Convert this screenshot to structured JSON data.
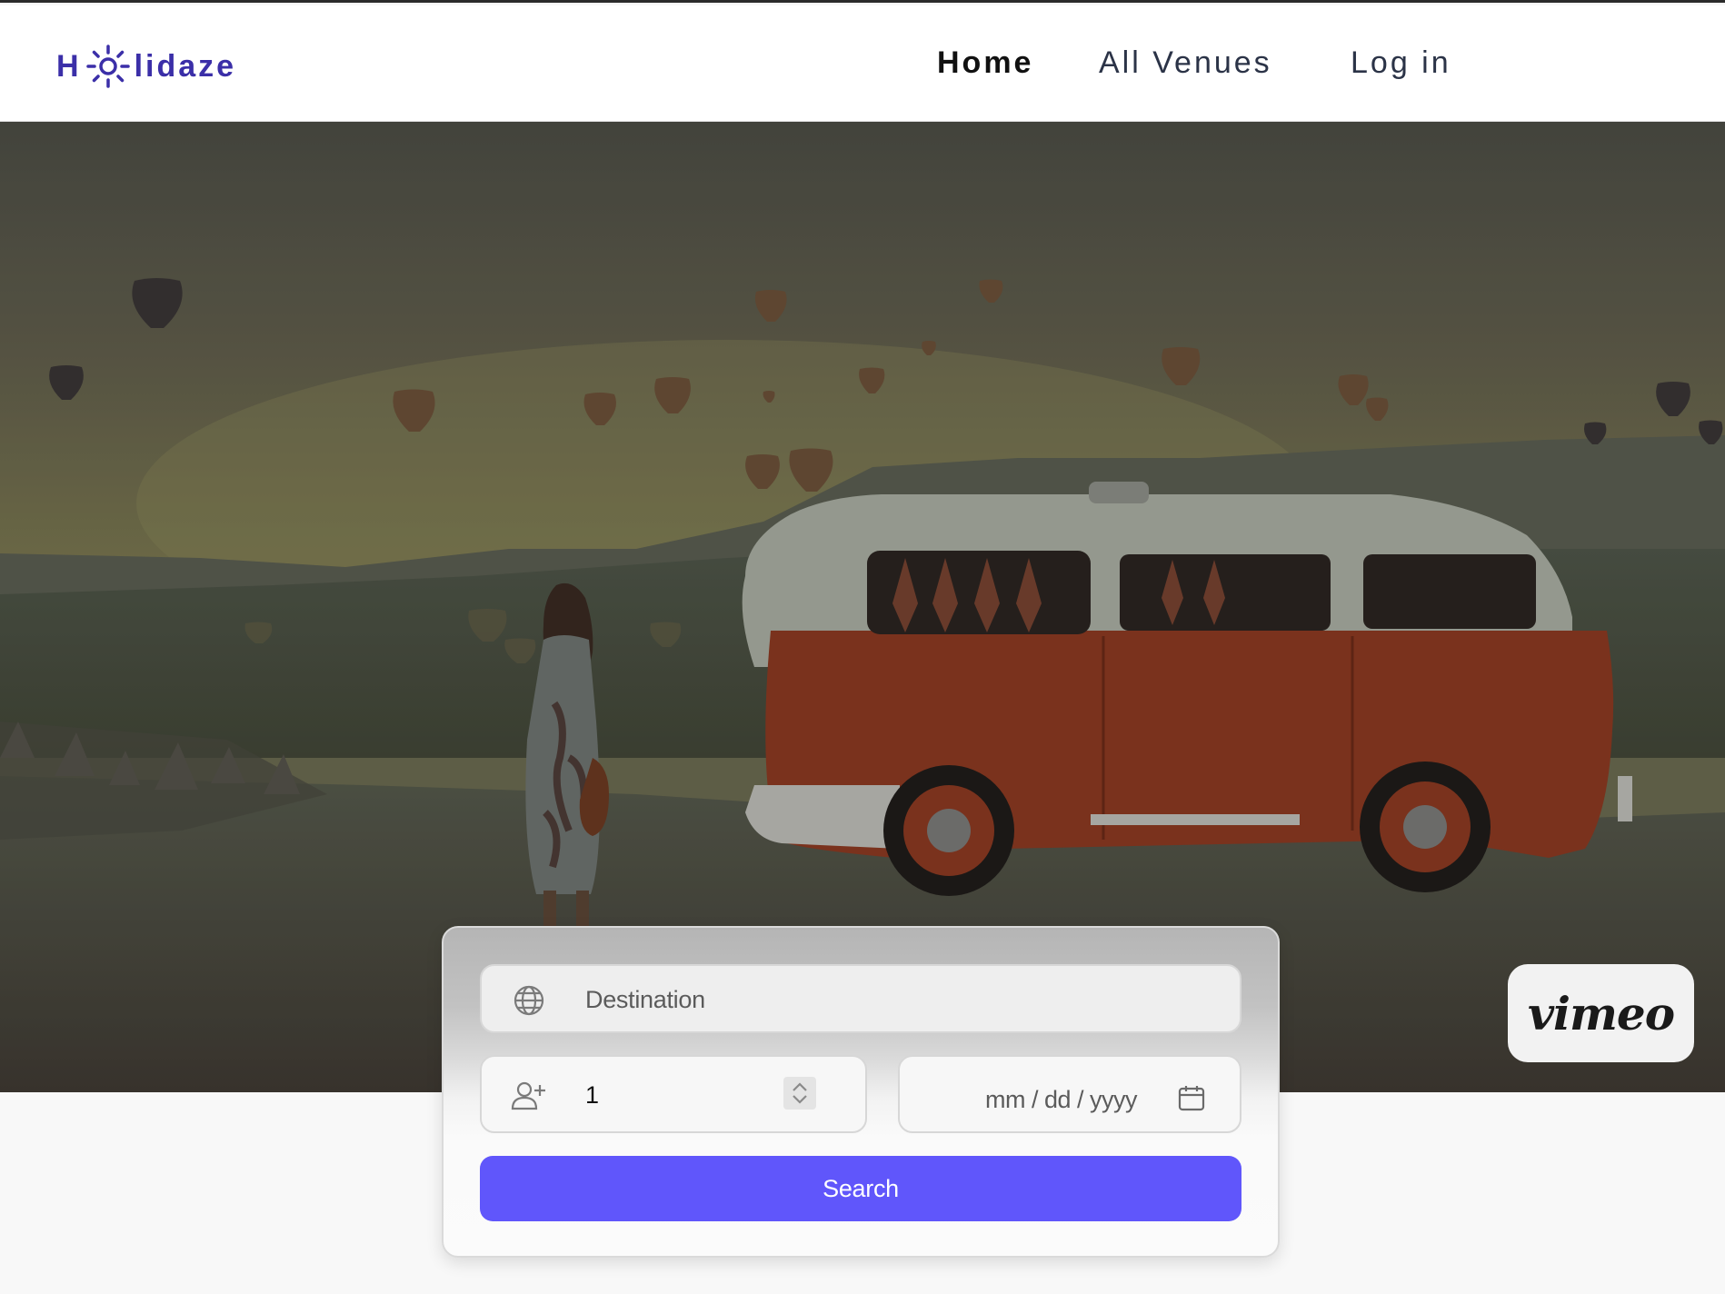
{
  "header": {
    "logo_text_left": "H",
    "logo_text_right": "lidaze",
    "nav": {
      "home": "Home",
      "venues": "All Venues",
      "login": "Log in"
    }
  },
  "hero": {
    "video_badge": "vimeo"
  },
  "search": {
    "destination_placeholder": "Destination",
    "guests_value": "1",
    "date_placeholder": "mm / dd / yyyy",
    "button_label": "Search"
  },
  "colors": {
    "brand": "#3b2fa8",
    "accent_button": "#6056fb",
    "van_red": "#8b3a22",
    "van_top": "#a9aea2"
  },
  "icons": {
    "logo": "sun-icon",
    "destination": "globe-icon",
    "guests": "add-user-icon",
    "guests_spinner": "stepper-icon",
    "date": "calendar-icon"
  }
}
